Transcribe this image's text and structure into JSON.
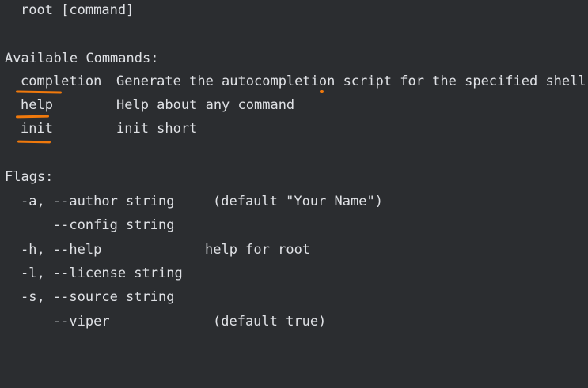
{
  "usage": {
    "line": "root [command]"
  },
  "commands": {
    "heading": "Available Commands:",
    "items": [
      {
        "name": "completion",
        "description": "Generate the autocompletion script for the specified shell"
      },
      {
        "name": "help",
        "description": "Help about any command"
      },
      {
        "name": "init",
        "description": "init short"
      }
    ]
  },
  "flags": {
    "heading": "Flags:",
    "items": [
      {
        "flag": "-a, --author string",
        "description": "(default \"Your Name\")"
      },
      {
        "flag": "    --config string",
        "description": ""
      },
      {
        "flag": "-h, --help",
        "description": "help for root"
      },
      {
        "flag": "-l, --license string",
        "description": ""
      },
      {
        "flag": "-s, --source string",
        "description": ""
      },
      {
        "flag": "    --viper",
        "description": "(default true)"
      }
    ]
  },
  "colors": {
    "background": "#2b2d30",
    "text": "#dfe1e5",
    "annotation": "#f0790c"
  }
}
